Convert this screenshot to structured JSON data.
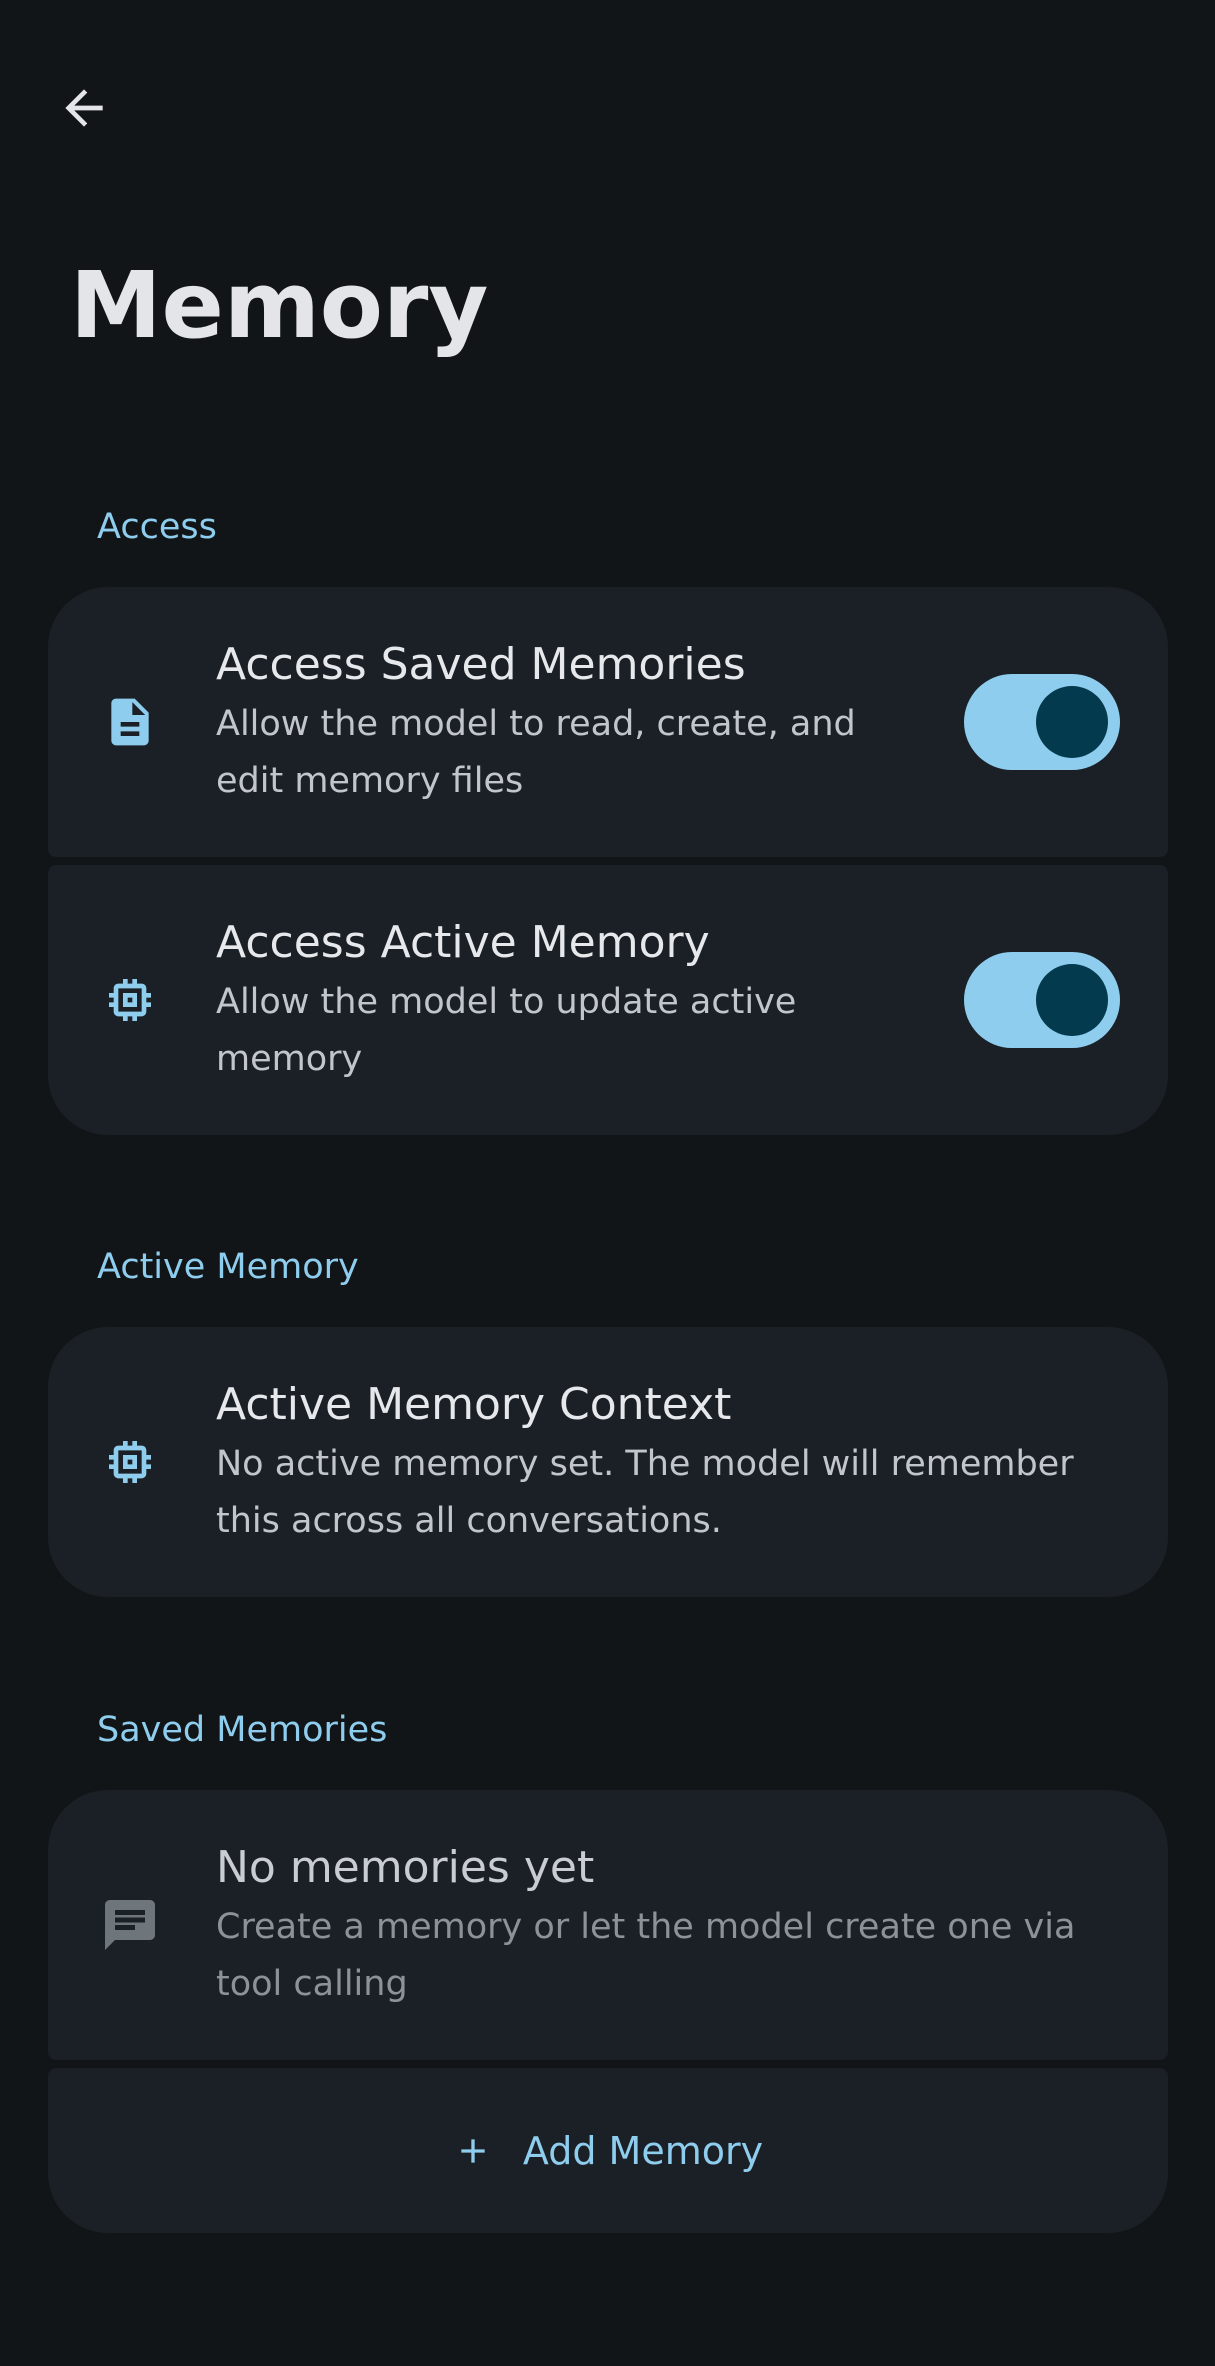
{
  "header": {
    "back_icon": "arrow-back-icon",
    "title": "Memory"
  },
  "sections": {
    "access": {
      "label": "Access",
      "items": [
        {
          "icon": "document-icon",
          "title": "Access Saved Memories",
          "description_line1": "Allow the model to read, create, and",
          "description_line2": "edit memory files",
          "toggle_on": true
        },
        {
          "icon": "chip-icon",
          "title": "Access Active Memory",
          "description_line1": "Allow the model to update active",
          "description_line2": "memory",
          "toggle_on": true
        }
      ]
    },
    "active_memory": {
      "label": "Active Memory",
      "item": {
        "icon": "chip-icon",
        "title": "Active Memory Context",
        "description_line1": "No active memory set. The model will remember",
        "description_line2": "this across all conversations."
      }
    },
    "saved_memories": {
      "label": "Saved Memories",
      "empty": {
        "icon": "message-icon",
        "title": "No memories yet",
        "description_line1": "Create a memory or let the model create one via",
        "description_line2": "tool calling"
      },
      "add_button": {
        "icon": "plus-icon",
        "label": "Add Memory"
      }
    }
  },
  "colors": {
    "background": "#111518",
    "card": "#1a2025",
    "accent": "#8fcdee",
    "toggle_knob": "#033a4d"
  }
}
